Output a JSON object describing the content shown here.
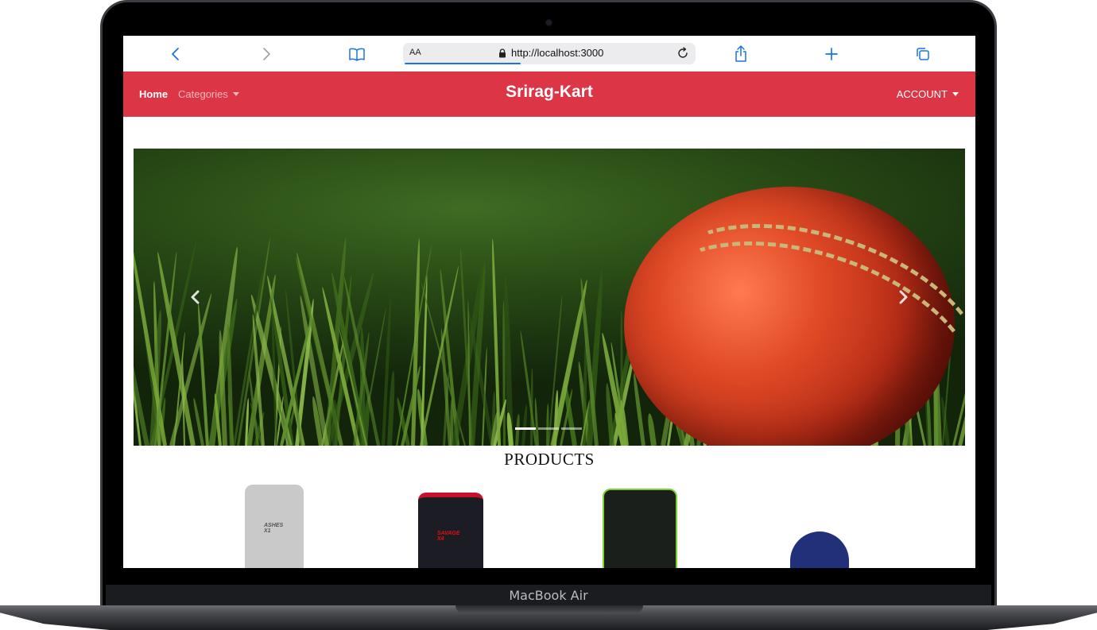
{
  "device": {
    "label": "MacBook Air"
  },
  "browser": {
    "address_prefix": "AA",
    "url": "http://localhost:3000",
    "icons": [
      "back-icon",
      "forward-icon",
      "bookmarks-icon",
      "lock-icon",
      "reload-icon",
      "share-icon",
      "new-tab-icon",
      "tabs-icon"
    ],
    "progress": 0.4
  },
  "navbar": {
    "color": "#dc3545",
    "home": "Home",
    "categories": "Categories",
    "brand": "Srirag-Kart",
    "account": "ACCOUNT"
  },
  "carousel": {
    "image": "cricket ball on grass",
    "slides": 3,
    "active_slide": 1,
    "prev_icon": "chevron-left-icon",
    "next_icon": "chevron-right-icon"
  },
  "products": {
    "title": "PRODUCTS",
    "items": [
      {
        "label": "ASHES X1",
        "color": "#c9c9c9"
      },
      {
        "label": "SAVAGE X4",
        "color": "#1c1d24"
      },
      {
        "label": "",
        "color": "#1a1f1c"
      },
      {
        "label": "",
        "color": "#22307a"
      }
    ]
  }
}
